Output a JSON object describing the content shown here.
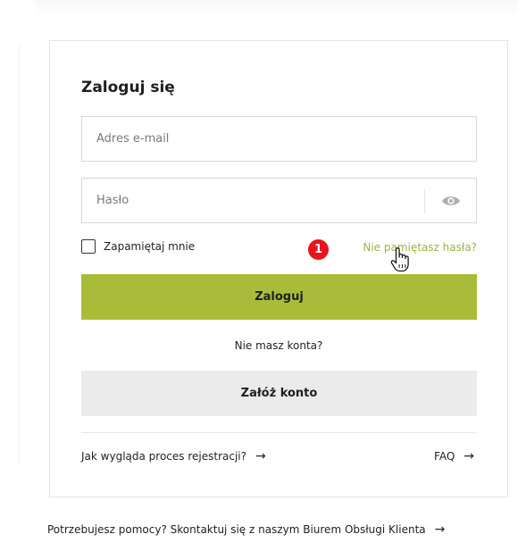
{
  "login": {
    "title": "Zaloguj się",
    "email_placeholder": "Adres e-mail",
    "password_placeholder": "Hasło",
    "remember_label": "Zapamiętaj mnie",
    "forgot_link": "Nie pamiętasz hasła?",
    "step_badge": "1",
    "login_button": "Zaloguj",
    "no_account_text": "Nie masz konta?",
    "register_button": "Załóż konto",
    "process_link": "Jak wygląda proces rejestracji?",
    "faq_link": "FAQ"
  },
  "footer": {
    "help_text": "Potrzebujesz pomocy? Skontaktuj się z naszym Biurem Obsługi Klienta"
  },
  "icons": {
    "arrow": "→",
    "eye": "eye-icon",
    "cursor": "hand-pointer-icon"
  },
  "colors": {
    "accent": "#a9bc3a",
    "link": "#96b53f",
    "badge": "#e8141b",
    "secondary_button": "#ebebeb"
  }
}
